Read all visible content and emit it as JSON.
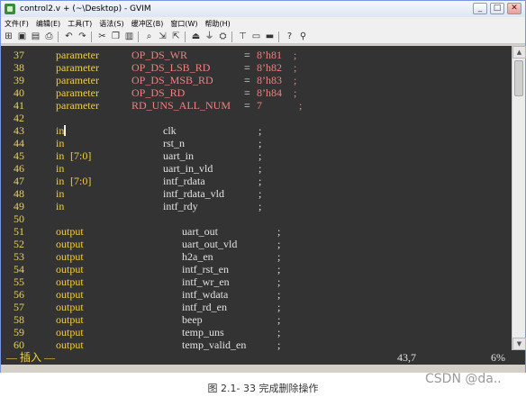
{
  "window": {
    "title": "control2.v + (~\\Desktop) - GVIM",
    "controls": [
      "_",
      "□",
      "✕"
    ]
  },
  "menu": [
    "文件(F)",
    "编辑(E)",
    "工具(T)",
    "语法(S)",
    "缓冲区(B)",
    "窗口(W)",
    "帮助(H)"
  ],
  "toolbar_icons": [
    "open-icon",
    "save-icon",
    "save-all-icon",
    "print-icon",
    "undo-icon",
    "redo-icon",
    "cut-icon",
    "copy-icon",
    "paste-icon",
    "find-icon",
    "find-next-icon",
    "find-prev-icon",
    "load-session-icon",
    "save-session-icon",
    "run-script-icon",
    "make-icon",
    "shell-icon",
    "tags-icon",
    "help-icon",
    "help-find-icon"
  ],
  "editor": {
    "lines": [
      {
        "n": "37",
        "kw": "parameter",
        "name": "OP_DS_WR",
        "op": "= ",
        "val": "8’h81",
        "tail": " ;"
      },
      {
        "n": "38",
        "kw": "parameter",
        "name": "OP_DS_LSB_RD",
        "op": "= ",
        "val": "8’h82",
        "tail": " ;"
      },
      {
        "n": "39",
        "kw": "parameter",
        "name": "OP_DS_MSB_RD",
        "op": "= ",
        "val": "8’h83",
        "tail": " ;"
      },
      {
        "n": "40",
        "kw": "parameter",
        "name": "OP_DS_RD",
        "op": "= ",
        "val": "8’h84",
        "tail": " ;"
      },
      {
        "n": "41",
        "kw": "parameter",
        "name": "RD_UNS_ALL_NUM",
        "op": "= ",
        "val": "7",
        "tail": "   ;"
      },
      {
        "n": "42"
      },
      {
        "n": "43",
        "dir": "in",
        "cursor": true,
        "sig": "clk",
        "semi": ";"
      },
      {
        "n": "44",
        "dir": "in",
        "sig": "rst_n",
        "semi": ";"
      },
      {
        "n": "45",
        "dir": "in",
        "width": "[7:0]",
        "sig": "uart_in",
        "semi": ";"
      },
      {
        "n": "46",
        "dir": "in",
        "sig": "uart_in_vld",
        "semi": ";"
      },
      {
        "n": "47",
        "dir": "in",
        "width": "[7:0]",
        "sig": "intf_rdata",
        "semi": ";"
      },
      {
        "n": "48",
        "dir": "in",
        "sig": "intf_rdata_vld",
        "semi": ";"
      },
      {
        "n": "49",
        "dir": "in",
        "sig": "intf_rdy",
        "semi": ";"
      },
      {
        "n": "50"
      },
      {
        "n": "51",
        "odir": "output",
        "sig": "uart_out",
        "semi": ";"
      },
      {
        "n": "52",
        "odir": "output",
        "sig": "uart_out_vld",
        "semi": ";"
      },
      {
        "n": "53",
        "odir": "output",
        "sig": "h2a_en",
        "semi": ";"
      },
      {
        "n": "54",
        "odir": "output",
        "sig": "intf_rst_en",
        "semi": ";"
      },
      {
        "n": "55",
        "odir": "output",
        "sig": "intf_wr_en",
        "semi": ";"
      },
      {
        "n": "56",
        "odir": "output",
        "sig": "intf_wdata",
        "semi": ";"
      },
      {
        "n": "57",
        "odir": "output",
        "sig": "intf_rd_en",
        "semi": ";"
      },
      {
        "n": "58",
        "odir": "output",
        "sig": "beep",
        "semi": ";"
      },
      {
        "n": "59",
        "odir": "output",
        "sig": "temp_uns",
        "semi": ";"
      },
      {
        "n": "60",
        "odir": "output",
        "sig": "temp_valid_en",
        "semi": ";"
      }
    ]
  },
  "status": {
    "mode": "— 插入 —",
    "position": "43,7",
    "percent": "6%"
  },
  "caption": "图 2.1- 33 完成删除操作",
  "watermark": "CSDN @da.."
}
